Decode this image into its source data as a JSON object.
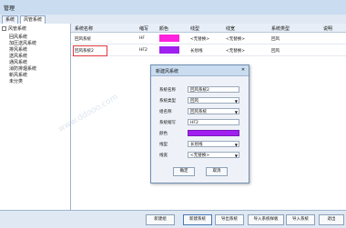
{
  "window": {
    "title": "管理"
  },
  "tabs": [
    {
      "label": "系统"
    },
    {
      "label": "风管系统"
    }
  ],
  "tree": {
    "root": "风管系统",
    "items": [
      "回风系统",
      "加压送风系统",
      "排风系统",
      "送风系统",
      "通风系统",
      "消防排烟系统",
      "新风系统",
      "未分类"
    ]
  },
  "grid": {
    "headers": [
      "系统名称",
      "缩写",
      "颜色",
      "线型",
      "线宽",
      "系统类型",
      "说明"
    ],
    "rows": [
      {
        "name": "回风系统",
        "abbr": "HF",
        "color": "#ff22dd",
        "linetype": "<无替换>",
        "linewidth": "<无替换>",
        "type": "回风"
      },
      {
        "name": "回风系统2",
        "abbr": "HF2",
        "color": "#a020f0",
        "linetype": "长划线",
        "linewidth": "<无替换>",
        "type": "回风"
      }
    ]
  },
  "dialog": {
    "title": "新建风系统",
    "labels": {
      "name": "系统名称",
      "type": "系统类型",
      "group": "组名称",
      "abbr": "系统缩写",
      "color": "颜色",
      "linetype": "线型",
      "linewidth": "线宽"
    },
    "values": {
      "name": "回风系统2",
      "type": "回风",
      "group": "回风系统",
      "abbr": "HF2",
      "color": "#a020f0",
      "linetype": "长划线",
      "linewidth": "<无替换>"
    },
    "ok": "确定",
    "cancel": "取消"
  },
  "footer": {
    "buttons": [
      "新建组",
      "新建系统",
      "导出系统",
      "导入系统样板",
      "导入系统",
      "退出"
    ]
  },
  "watermark": "www.ddooo.com"
}
